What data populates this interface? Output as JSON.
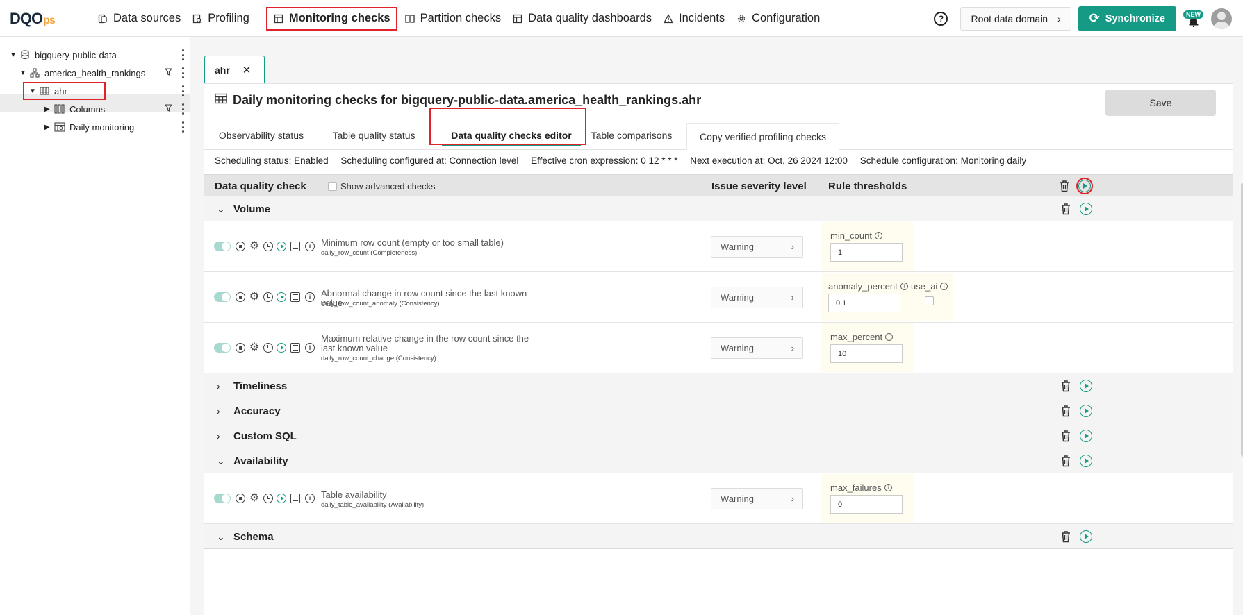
{
  "app": {
    "logo_main": "DQO",
    "logo_suffix": "ps"
  },
  "nav": {
    "items": [
      {
        "label": "Data sources",
        "icon": "data-sources-icon"
      },
      {
        "label": "Profiling",
        "icon": "profiling-icon"
      },
      {
        "label": "Monitoring checks",
        "icon": "monitoring-icon"
      },
      {
        "label": "Partition checks",
        "icon": "partition-icon"
      },
      {
        "label": "Data quality dashboards",
        "icon": "dashboard-icon"
      },
      {
        "label": "Incidents",
        "icon": "warning-icon"
      },
      {
        "label": "Configuration",
        "icon": "gear-icon"
      }
    ],
    "active_index": 2
  },
  "header": {
    "help": "?",
    "domain_label": "Root data domain",
    "sync_label": "Synchronize",
    "new_badge": "NEW"
  },
  "tree": {
    "connection": "bigquery-public-data",
    "schema": "america_health_rankings",
    "table": "ahr",
    "columns": "Columns",
    "monitoring": "Daily monitoring"
  },
  "editor": {
    "tab_label": "ahr",
    "title": "Daily monitoring checks for bigquery-public-data.america_health_rankings.ahr",
    "save_label": "Save",
    "subtabs": [
      "Observability status",
      "Table quality status",
      "Data quality checks editor",
      "Table comparisons",
      "Copy verified profiling checks"
    ],
    "active_subtab": 2,
    "schedule": {
      "status_label": "Scheduling status:",
      "status_value": "Enabled",
      "configured_label": "Scheduling configured at:",
      "configured_value": "Connection level",
      "cron_label": "Effective cron expression:",
      "cron_value": "0 12 * * *",
      "next_label": "Next execution at:",
      "next_value": "Oct, 26 2024 12:00",
      "config_label": "Schedule configuration:",
      "config_value": "Monitoring daily"
    },
    "table_headers": {
      "check": "Data quality check",
      "advanced": "Show advanced checks",
      "severity": "Issue severity level",
      "thresholds": "Rule thresholds"
    },
    "groups": [
      {
        "name": "Volume",
        "expanded": true
      },
      {
        "name": "Timeliness",
        "expanded": false
      },
      {
        "name": "Accuracy",
        "expanded": false
      },
      {
        "name": "Custom SQL",
        "expanded": false
      },
      {
        "name": "Availability",
        "expanded": true
      },
      {
        "name": "Schema",
        "expanded": true
      }
    ],
    "checks": [
      {
        "title": "Minimum row count (empty or too small table)",
        "subtitle": "daily_row_count (Completeness)",
        "severity": "Warning",
        "param_label": "min_count",
        "param_value": "1"
      },
      {
        "title": "Abnormal change in row count since the last known value",
        "subtitle": "daily_row_count_anomaly (Consistency)",
        "severity": "Warning",
        "param_label": "anomaly_percent",
        "param_value": "0.1",
        "extra_label": "use_ai"
      },
      {
        "title": "Maximum relative change in the row count since the last known value",
        "subtitle": "daily_row_count_change (Consistency)",
        "severity": "Warning",
        "param_label": "max_percent",
        "param_value": "10"
      },
      {
        "title": "Table availability",
        "subtitle": "daily_table_availability (Availability)",
        "severity": "Warning",
        "param_label": "max_failures",
        "param_value": "0"
      }
    ]
  },
  "colors": {
    "accent": "#149a85",
    "highlight": "#e0222a",
    "brand_orange": "#f2a33a"
  }
}
